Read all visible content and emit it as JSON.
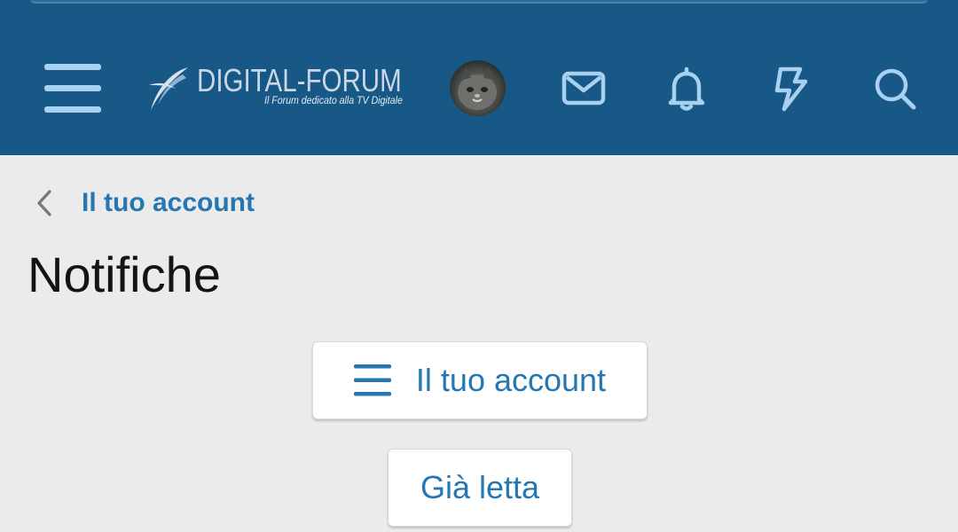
{
  "header": {
    "logo": {
      "brand_left": "DIGITAL",
      "brand_dash": "-",
      "brand_right": "FORUM",
      "tagline": "Il Forum dedicato alla TV Digitale"
    },
    "icons": [
      "menu-icon",
      "avatar",
      "envelope-icon",
      "bell-icon",
      "bolt-icon",
      "search-icon"
    ],
    "colors": {
      "bar": "#185886",
      "icon": "#a8d0f0"
    }
  },
  "breadcrumb": {
    "back_label": "Il tuo account"
  },
  "page": {
    "title": "Notifiche"
  },
  "buttons": {
    "account_menu": "Il tuo account",
    "mark_read": "Già letta"
  },
  "colors": {
    "link": "#2577b1",
    "background": "#ebebeb"
  }
}
